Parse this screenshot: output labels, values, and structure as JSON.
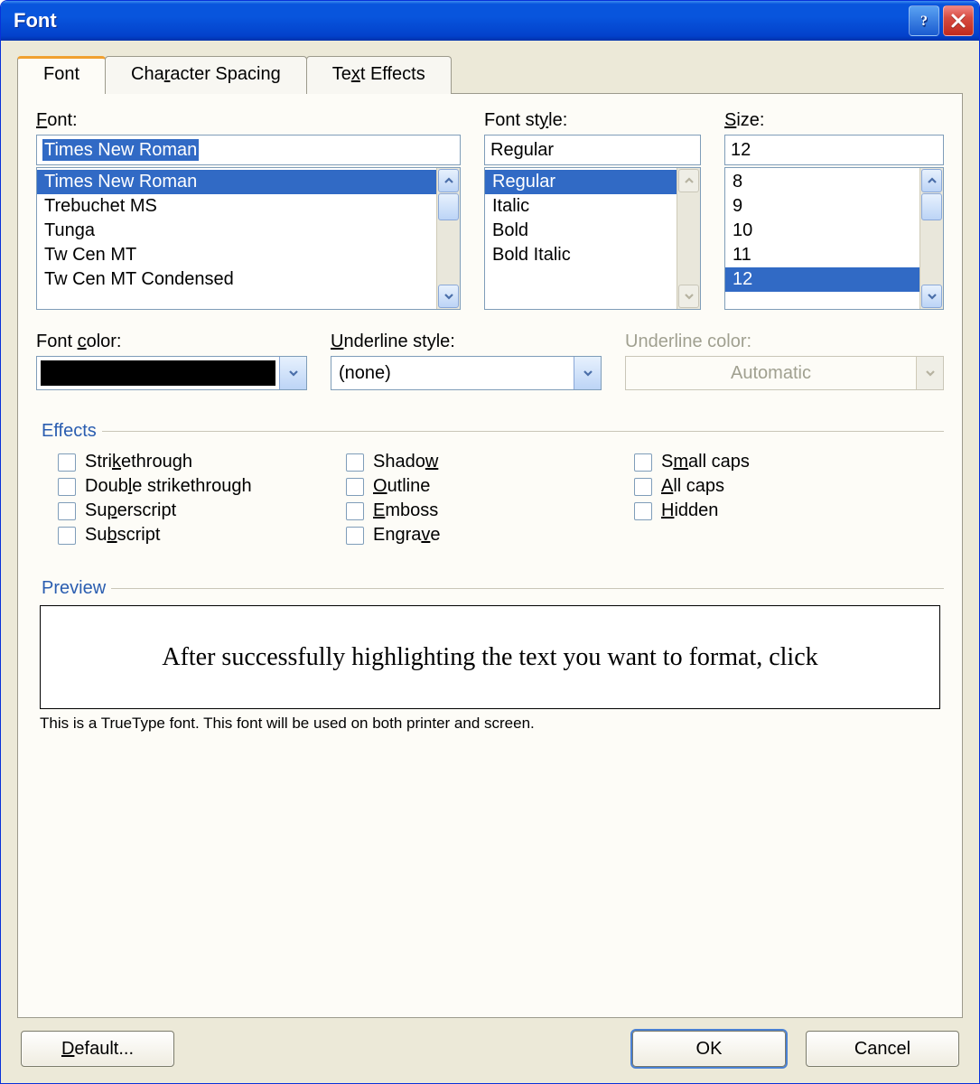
{
  "window": {
    "title": "Font"
  },
  "tabs": {
    "font": "Font",
    "spacing": "Character Spacing",
    "effects": "Text Effects"
  },
  "font": {
    "label": "Font:",
    "value": "Times New Roman",
    "items": [
      "Times New Roman",
      "Trebuchet MS",
      "Tunga",
      "Tw Cen MT",
      "Tw Cen MT Condensed"
    ]
  },
  "style": {
    "label": "Font style:",
    "value": "Regular",
    "items": [
      "Regular",
      "Italic",
      "Bold",
      "Bold Italic"
    ]
  },
  "size": {
    "label": "Size:",
    "value": "12",
    "items": [
      "8",
      "9",
      "10",
      "11",
      "12"
    ]
  },
  "fontcolor": {
    "label": "Font color:"
  },
  "underline": {
    "label": "Underline style:",
    "value": "(none)"
  },
  "ulcolor": {
    "label": "Underline color:",
    "value": "Automatic"
  },
  "effectsLegend": "Effects",
  "eff": {
    "strike": "Strikethrough",
    "dstrike": "Double strikethrough",
    "sup": "Superscript",
    "sub": "Subscript",
    "shadow": "Shadow",
    "outline": "Outline",
    "emboss": "Emboss",
    "engrave": "Engrave",
    "smallcaps": "Small caps",
    "allcaps": "All caps",
    "hidden": "Hidden"
  },
  "previewLegend": "Preview",
  "previewText": "After successfully highlighting the text you want to format, click",
  "hint": "This is a TrueType font. This font will be used on both printer and screen.",
  "buttons": {
    "default": "Default...",
    "ok": "OK",
    "cancel": "Cancel"
  }
}
